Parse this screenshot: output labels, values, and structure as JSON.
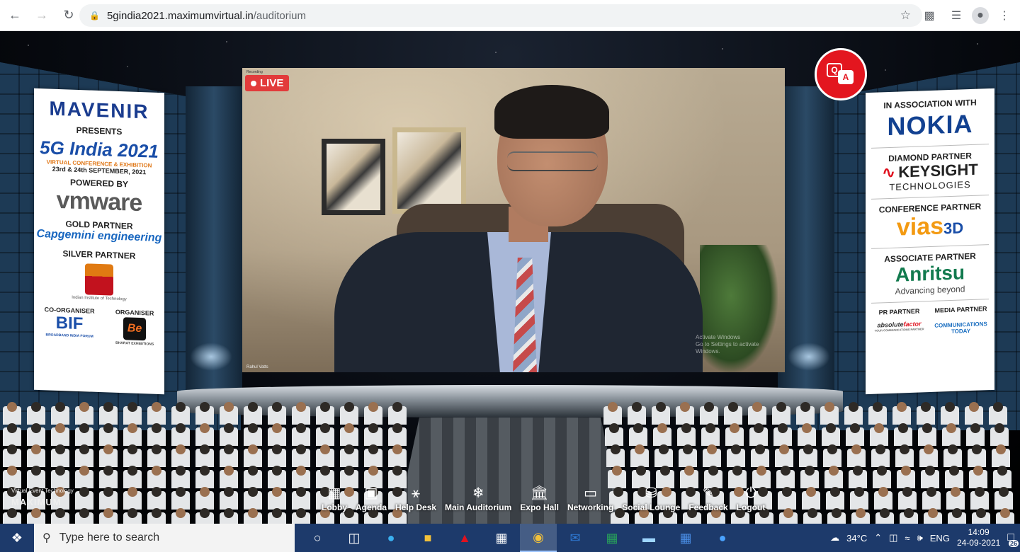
{
  "browser": {
    "url_host": "5gindia2021.maximumvirtual.in",
    "url_path": "/auditorium"
  },
  "video": {
    "live_label": "LIVE",
    "recording_label": "Recording",
    "speaker_name": "Rahul Vatts",
    "activate_line1": "Activate Windows",
    "activate_line2": "Go to Settings to activate Windows."
  },
  "qa": {
    "q": "Q",
    "a": "A"
  },
  "left_banner": {
    "mavenir": "MAVENIR",
    "presents": "PRESENTS",
    "event_name": "5G India 2021",
    "event_sub": "VIRTUAL CONFERENCE & EXHIBITION",
    "event_date": "23rd & 24th SEPTEMBER, 2021",
    "powered_by": "POWERED BY",
    "vmware": "vmware",
    "gold_partner": "GOLD PARTNER",
    "capgemini": "Capgemini engineering",
    "silver_partner": "SILVER PARTNER",
    "silver_sub": "Indian Institute of Technology",
    "co_organiser": "CO-ORGANISER",
    "organiser": "ORGANISER",
    "bif": "BIF",
    "bif_sub": "BROADBAND INDIA FORUM",
    "be": "Be",
    "be_sub": "BHARAT EXHIBITIONS"
  },
  "right_banner": {
    "association": "IN ASSOCIATION WITH",
    "nokia": "NOKIA",
    "diamond_partner": "DIAMOND PARTNER",
    "keysight": "KEYSIGHT",
    "keysight_sub": "TECHNOLOGIES",
    "conference_partner": "CONFERENCE PARTNER",
    "vias": "vias",
    "vias_3d": "3D",
    "associate_partner": "ASSOCIATE PARTNER",
    "anritsu": "Anritsu",
    "anritsu_sub": "Advancing beyond",
    "pr_partner": "PR PARTNER",
    "media_partner": "MEDIA PARTNER",
    "absolute_a": "absolute",
    "absolute_b": "factor",
    "absolute_sub": "YOUR COMMUNICATIONS PARTNER",
    "comms_line1": "COMMUNICATIONS",
    "comms_line2": "TODAY"
  },
  "branding": {
    "tagline": "Virtual Event Technology",
    "name": "MAXIMUM"
  },
  "nav": [
    {
      "label": "Lobby",
      "icon": "grid-icon"
    },
    {
      "label": "Agenda",
      "icon": "calendar-icon"
    },
    {
      "label": "Help Desk",
      "icon": "chat-icon"
    },
    {
      "label": "Main Auditorium",
      "icon": "snowflake-icon"
    },
    {
      "label": "Expo Hall",
      "icon": "building-icon"
    },
    {
      "label": "Networking",
      "icon": "card-icon"
    },
    {
      "label": "Social Lounge",
      "icon": "database-icon"
    },
    {
      "label": "Feedback",
      "icon": "edit-icon"
    },
    {
      "label": "Logout",
      "icon": "power-icon"
    }
  ],
  "taskbar": {
    "search_placeholder": "Type here to search",
    "temperature": "34°C",
    "language": "ENG",
    "time": "14:09",
    "date": "24-09-2021",
    "notifications": "26"
  }
}
